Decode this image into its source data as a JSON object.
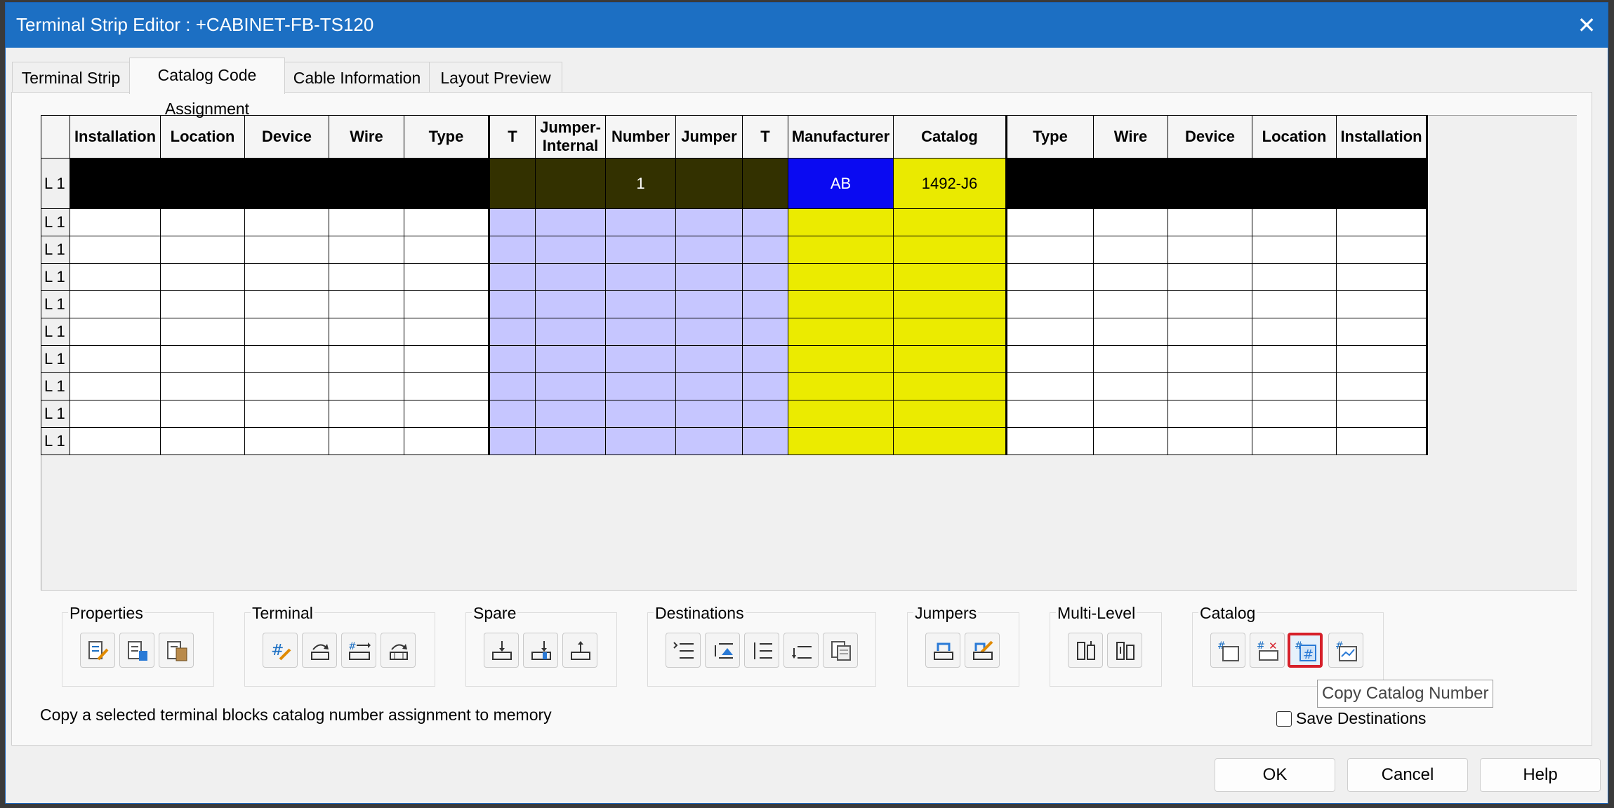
{
  "window": {
    "title": "Terminal Strip Editor : +CABINET-FB-TS120",
    "close_glyph": "✕"
  },
  "tabs": [
    {
      "label": "Terminal Strip",
      "active": false
    },
    {
      "label": "Catalog Code Assignment",
      "active": true
    },
    {
      "label": "Cable Information",
      "active": false
    },
    {
      "label": "Layout Preview",
      "active": false
    }
  ],
  "grid": {
    "headers": [
      "",
      "Installation",
      "Location",
      "Device",
      "Wire",
      "Type",
      "T",
      "Jumper-Internal",
      "Number",
      "Jumper",
      "T",
      "Manufacturer",
      "Catalog",
      "Type",
      "Wire",
      "Device",
      "Location",
      "Installation"
    ],
    "selected_row": {
      "label": "L 1",
      "number": "1",
      "manufacturer": "AB",
      "catalog": "1492-J6"
    },
    "row_labels": [
      "L 1",
      "L 1",
      "L 1",
      "L 1",
      "L 1",
      "L 1",
      "L 1",
      "L 1",
      "L 1"
    ]
  },
  "groups": [
    {
      "label": "Properties",
      "icons": [
        "edit-properties-icon",
        "copy-properties-icon",
        "paste-properties-icon"
      ]
    },
    {
      "label": "Terminal",
      "icons": [
        "edit-terminal-icon",
        "rotate-terminal-icon",
        "move-terminal-icon",
        "reverse-terminal-icon"
      ]
    },
    {
      "label": "Spare",
      "icons": [
        "insert-spare-icon",
        "add-spare-icon",
        "delete-spare-icon"
      ]
    },
    {
      "label": "Destinations",
      "icons": [
        "split-destinations-icon",
        "swap-destinations-icon",
        "flip-destinations-icon",
        "move-destination-icon",
        "destination-list-icon"
      ]
    },
    {
      "label": "Jumpers",
      "icons": [
        "jumper-icon",
        "edit-jumper-icon"
      ]
    },
    {
      "label": "Multi-Level",
      "icons": [
        "multilevel-add-icon",
        "multilevel-remove-icon"
      ]
    },
    {
      "label": "Catalog",
      "icons": [
        "assign-catalog-icon",
        "delete-catalog-icon",
        "copy-catalog-icon",
        "paste-catalog-icon"
      ]
    }
  ],
  "status_text": "Copy a selected terminal blocks catalog number assignment to memory",
  "tooltip": "Copy Catalog Number",
  "save_destinations": {
    "label": "Save Destinations",
    "checked": false
  },
  "buttons": {
    "ok": "OK",
    "cancel": "Cancel",
    "help": "Help"
  },
  "colors": {
    "title_bar": "#1c6fc3",
    "selected_row": "#000000",
    "jumper_columns": "#c6c6ff",
    "catalog_columns": "#ebeb00",
    "manufacturer_selected": "#0a0af2",
    "highlight_border": "#d6202a"
  }
}
